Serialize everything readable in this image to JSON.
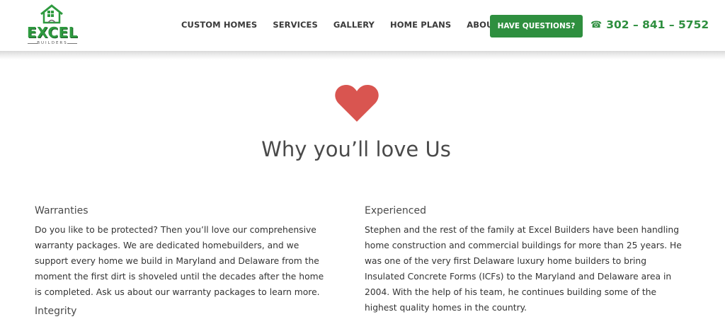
{
  "brand": {
    "logo_text": "EXCEL",
    "logo_sub": "BUILDERS",
    "accent": "#2e8f3f"
  },
  "nav": {
    "items": [
      "CUSTOM HOMES",
      "SERVICES",
      "GALLERY",
      "HOME PLANS",
      "ABOUT US"
    ],
    "cta_label": "HAVE QUESTIONS?",
    "phone": "302 – 841 – 5752"
  },
  "hero": {
    "title": "Why you’ll love Us",
    "heart_color": "#d95550"
  },
  "sections": {
    "warranties": {
      "heading": "Warranties",
      "body": "Do you like to be protected? Then you’ll love our comprehensive warranty packages. We are dedicated homebuilders, and we support every home we build in Maryland and Delaware from the moment the first dirt is shoveled until the decades after the home is completed. Ask us about our warranty packages to learn more."
    },
    "integrity": {
      "heading": "Integrity"
    },
    "experienced": {
      "heading": "Experienced",
      "body": "Stephen and the rest of the family at Excel Builders have been handling home construction and commercial buildings for more than 25 years. He was one of the very first Delaware luxury home builders to bring Insulated Concrete Forms (ICFs) to the Maryland and Delaware area in 2004. With the help of his team, he continues building some of the highest quality homes in the country."
    }
  }
}
